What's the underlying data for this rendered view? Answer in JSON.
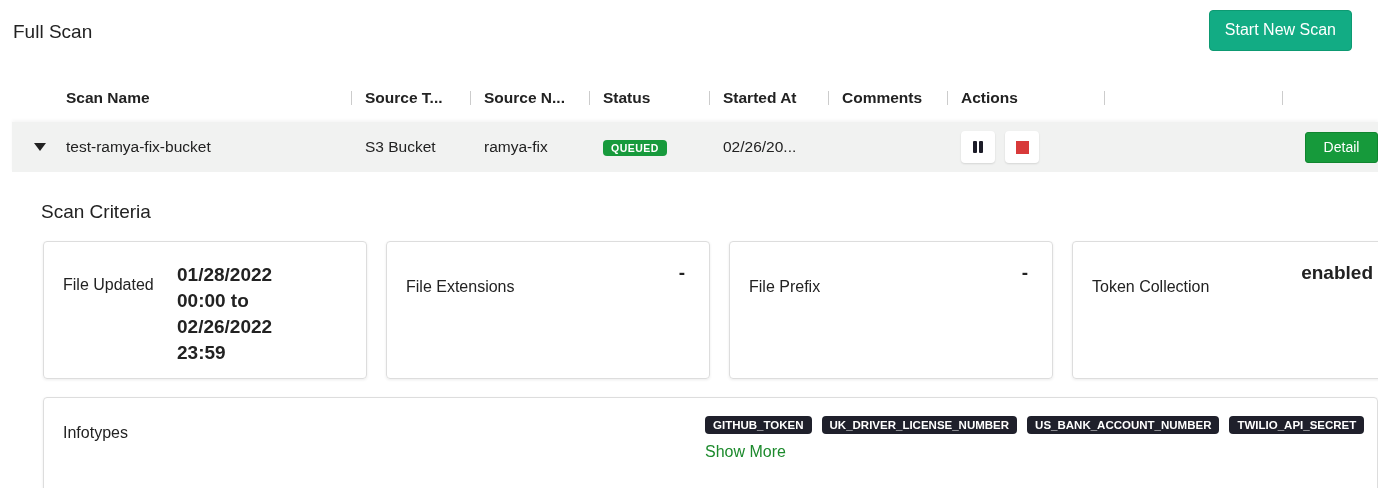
{
  "title": "Full Scan",
  "new_scan_button": "Start New Scan",
  "table": {
    "columns": [
      "Scan Name",
      "Source T...",
      "Source N...",
      "Status",
      "Started At",
      "Comments",
      "Actions"
    ],
    "rows": [
      {
        "expanded": true,
        "scan_name": "test-ramya-fix-bucket",
        "source_type": "S3 Bucket",
        "source_name": "ramya-fix",
        "status": "QUEUED",
        "started_at": "02/26/20...",
        "detail_button": "Detail"
      }
    ]
  },
  "scan_criteria": {
    "title": "Scan Criteria",
    "cards": [
      {
        "label": "File Updated",
        "value": "01/28/2022 00:00 to 02/26/2022 23:59"
      },
      {
        "label": "File Extensions",
        "value": "-"
      },
      {
        "label": "File Prefix",
        "value": "-"
      },
      {
        "label": "Token Collection",
        "value": "enabled"
      }
    ],
    "infotypes": {
      "label": "Infotypes",
      "tags": [
        "GITHUB_TOKEN",
        "UK_DRIVER_LICENSE_NUMBER",
        "US_BANK_ACCOUNT_NUMBER",
        "TWILIO_API_SECRET"
      ],
      "show_more": "Show More"
    }
  }
}
